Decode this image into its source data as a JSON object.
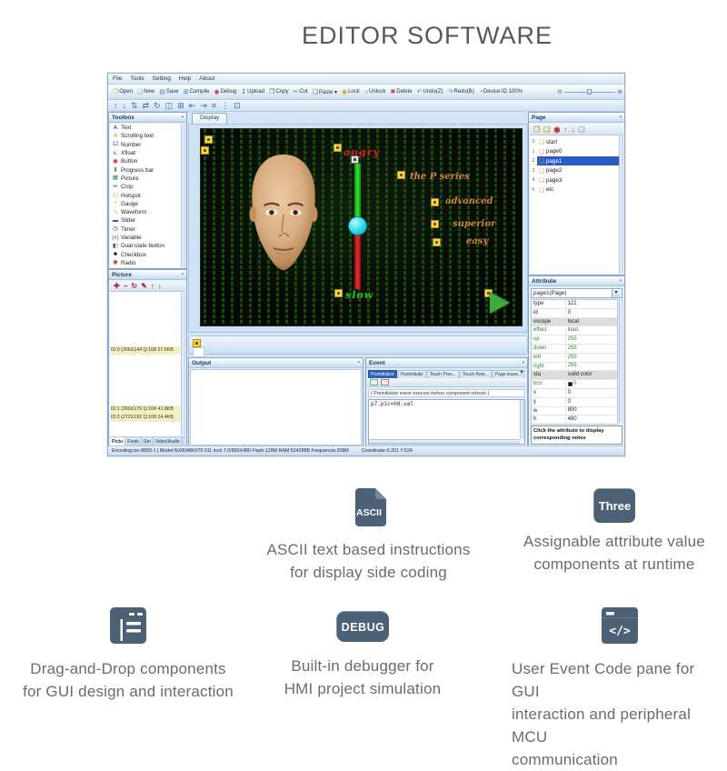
{
  "page": {
    "title": "EDITOR SOFTWARE"
  },
  "editor": {
    "menu": [
      "File",
      "Tools",
      "Setting",
      "Help",
      "About"
    ],
    "toolbar_main": [
      {
        "label": "Open",
        "g": "❐",
        "c": "#dba63a"
      },
      {
        "label": "New",
        "g": "❏",
        "c": "#8aa5c0"
      },
      {
        "label": "Save",
        "g": "▤",
        "c": "#5b7fae"
      },
      {
        "label": "Compile",
        "g": "⊞",
        "c": "#4a7ebb"
      },
      {
        "label": "Debug",
        "g": "◉",
        "c": "#c23a3a"
      },
      {
        "label": "Upload",
        "g": "↧",
        "c": "#2e8b2e"
      },
      {
        "label": "Copy",
        "g": "❒",
        "c": "#2e8b2e"
      },
      {
        "label": "Cut",
        "g": "✂",
        "c": "#4a7ebb"
      },
      {
        "label": "Paste ▾",
        "g": "❑",
        "c": "#a0622d"
      },
      {
        "label": "Lock",
        "g": "◉",
        "c": "#d4a017"
      },
      {
        "label": "Unlock",
        "g": "○",
        "c": "#2e8b2e"
      },
      {
        "label": "Delete",
        "g": "✖",
        "c": "#c23a3a"
      },
      {
        "label": "Undo(Z)",
        "g": "↶",
        "c": "#4a7ebb"
      },
      {
        "label": "Redo(B)",
        "g": "↷",
        "c": "#4a7ebb"
      },
      {
        "label": "Device ID 100%",
        "g": "◔",
        "c": "#777777"
      }
    ],
    "device_slider": {
      "minus": "⊖",
      "plus": "⊕"
    },
    "align_icons": [
      "↑",
      "↓",
      "⇅",
      "⇄",
      "↻",
      "◫",
      "⊞",
      "⇤",
      "⇥",
      "≡",
      "⋮",
      "⊡"
    ],
    "display_tab": "Display",
    "toolbox": {
      "title": "Toolbox",
      "items": [
        {
          "label": "Text",
          "g": "A",
          "c": "#111111"
        },
        {
          "label": "Scrolling text",
          "g": "A",
          "c": "#b8860b"
        },
        {
          "label": "Number",
          "g": "12",
          "c": "#1a5fbf"
        },
        {
          "label": "Xfloat",
          "g": "x.",
          "c": "#1a5fbf"
        },
        {
          "label": "Button",
          "g": "◉",
          "c": "#c81e1e"
        },
        {
          "label": "Progress bar",
          "g": "▮",
          "c": "#888888"
        },
        {
          "label": "Picture",
          "g": "▦",
          "c": "#2e8b2e"
        },
        {
          "label": "Crop",
          "g": "✂",
          "c": "#333333"
        },
        {
          "label": "Hotspot",
          "g": "◱",
          "c": "#c9a227"
        },
        {
          "label": "Gauge",
          "g": "◔",
          "c": "#2e8b2e"
        },
        {
          "label": "Waveform",
          "g": "∿",
          "c": "#c9a227"
        },
        {
          "label": "Slider",
          "g": "▬",
          "c": "#1a5fbf"
        },
        {
          "label": "Timer",
          "g": "◷",
          "c": "#333333"
        },
        {
          "label": "Variable",
          "g": "(x)",
          "c": "#555555"
        },
        {
          "label": "Dual-state button",
          "g": "◧",
          "c": "#555555"
        },
        {
          "label": "Checkbox",
          "g": "■",
          "c": "#111111"
        },
        {
          "label": "Radio",
          "g": "◉",
          "c": "#c81e1e"
        }
      ]
    },
    "picture_panel": {
      "title": "Picture",
      "tools": [
        {
          "g": "✚"
        },
        {
          "g": "−"
        },
        {
          "g": "↻"
        },
        {
          "g": "✎"
        },
        {
          "g": "↑"
        },
        {
          "g": "↓"
        }
      ],
      "items": [
        "ID:0 (266X144 Q:108 27.6KB",
        "ID:1 (266X176 Q:108 41.8KB",
        "ID:2 (272X192 Q:108 24.4KB"
      ],
      "tabs": [
        {
          "label": "Pictu",
          "active": true
        },
        {
          "label": "Fonts"
        },
        {
          "label": "Gm"
        },
        {
          "label": "Video/Audio"
        }
      ]
    },
    "canvas": {
      "top_label": "angry",
      "bottom_label": "slow",
      "series_label": "the P series",
      "right_labels": [
        "advanced",
        "superior",
        "easy"
      ]
    },
    "output_panel": {
      "title": "Output"
    },
    "event_panel": {
      "title": "Event",
      "tabs": [
        {
          "label": "Preinitialize",
          "active": true
        },
        {
          "label": "Postinitializ"
        },
        {
          "label": "Touch Pres..."
        },
        {
          "label": "Touch Rele..."
        },
        {
          "label": "Page leave..."
        }
      ],
      "note": "( Preinitialize event execute before component refresh )",
      "code": "p7.pic=h0.val"
    },
    "page_panel": {
      "title": "Page",
      "tools": [
        {
          "g": "❐",
          "c": "#c9a227"
        },
        {
          "g": "❏",
          "c": "#c9a227"
        },
        {
          "g": "◉",
          "c": "#b8312f"
        },
        {
          "g": "↑",
          "c": "#b8312f"
        },
        {
          "g": "↓",
          "c": "#b8312f"
        },
        {
          "g": "❏",
          "c": "#9aa7b5"
        }
      ],
      "items": [
        {
          "num": "0",
          "g": "❏",
          "label": "start"
        },
        {
          "num": "1",
          "g": "❏",
          "label": "page0"
        },
        {
          "num": "2",
          "g": "❏",
          "label": "page1",
          "selected": true
        },
        {
          "num": "3",
          "g": "❏",
          "label": "page2"
        },
        {
          "num": "4",
          "g": "❏",
          "label": "page3"
        },
        {
          "num": "5",
          "g": "❏",
          "label": "etc"
        }
      ]
    },
    "attribute_panel": {
      "title": "Attribute",
      "selector": "page1(Page)",
      "rows": [
        {
          "name": "type",
          "value": "121"
        },
        {
          "name": "id",
          "value": "0"
        },
        {
          "name": "vscope",
          "value": "local",
          "style": "hdr"
        },
        {
          "name": "effect",
          "value": "load",
          "style": "g"
        },
        {
          "name": "up",
          "value": "255",
          "style": "g"
        },
        {
          "name": "down",
          "value": "255",
          "style": "g"
        },
        {
          "name": "left",
          "value": "255",
          "style": "g"
        },
        {
          "name": "right",
          "value": "255",
          "style": "g"
        },
        {
          "name": "sta",
          "value": "solid color",
          "style": "hdr"
        },
        {
          "name": "bco",
          "value": "0",
          "style": "g",
          "swatch": true
        },
        {
          "name": "x",
          "value": "0"
        },
        {
          "name": "y",
          "value": "0"
        },
        {
          "name": "w",
          "value": "800"
        },
        {
          "name": "h",
          "value": "480"
        }
      ],
      "note": "Click the attribute to display corresponding notes"
    },
    "statusbar": {
      "info": "Encoding:iso-8859-1 | Model:NX8048K070  011 inch 7.0/800X480 Flash:128M RAM:524288B Frequencia:208M",
      "coordinate": "Coordinate:X:201 Y:524"
    }
  },
  "features": {
    "ascii": {
      "badge": "ASCII",
      "lines": [
        "ASCII text based instructions",
        "for display side coding"
      ]
    },
    "three": {
      "badge": "Three",
      "lines": [
        "Assignable attribute value",
        "components at runtime"
      ]
    },
    "dragdrop": {
      "lines": [
        "Drag-and-Drop components",
        "for GUI design and interaction"
      ]
    },
    "debug": {
      "badge": "DEBUG",
      "lines": [
        "Built-in debugger for",
        "HMI project simulation"
      ]
    },
    "code": {
      "lines": [
        "User Event Code pane for GUI",
        "interaction and peripheral MCU",
        "communication"
      ]
    }
  }
}
